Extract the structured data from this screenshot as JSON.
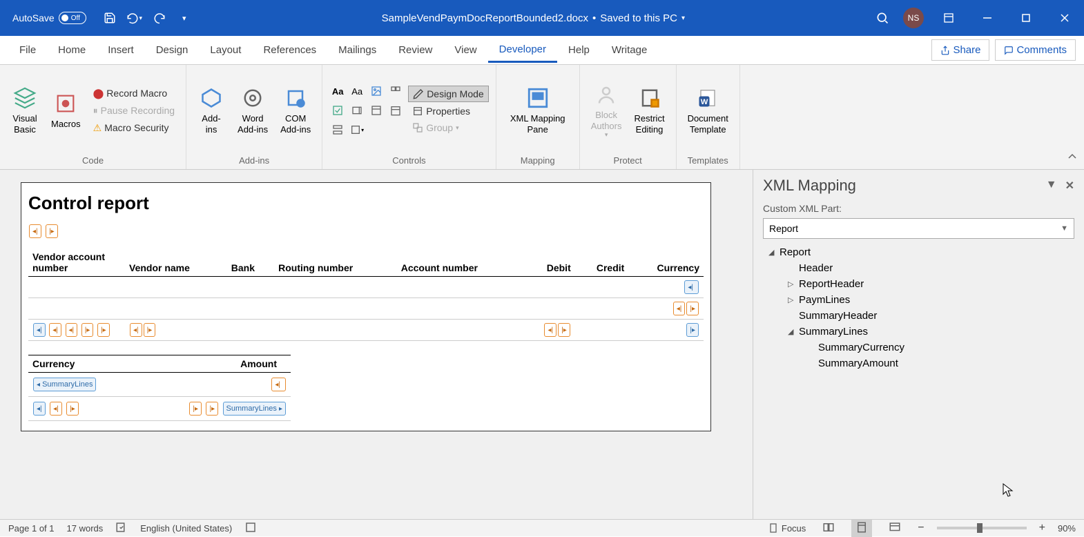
{
  "titlebar": {
    "autosave_label": "AutoSave",
    "autosave_state": "Off",
    "filename": "SampleVendPaymDocReportBounded2.docx",
    "save_status": "Saved to this PC",
    "user_initials": "NS"
  },
  "tabs": {
    "file": "File",
    "home": "Home",
    "insert": "Insert",
    "design": "Design",
    "layout": "Layout",
    "references": "References",
    "mailings": "Mailings",
    "review": "Review",
    "view": "View",
    "developer": "Developer",
    "help": "Help",
    "writage": "Writage",
    "share": "Share",
    "comments": "Comments"
  },
  "ribbon": {
    "code": {
      "label": "Code",
      "visual_basic": "Visual\nBasic",
      "macros": "Macros",
      "record_macro": "Record Macro",
      "pause_recording": "Pause Recording",
      "macro_security": "Macro Security"
    },
    "addins": {
      "label": "Add-ins",
      "add_ins": "Add-\nins",
      "word_addins": "Word\nAdd-ins",
      "com_addins": "COM\nAdd-ins"
    },
    "controls": {
      "label": "Controls",
      "design_mode": "Design Mode",
      "properties": "Properties",
      "group": "Group"
    },
    "mapping": {
      "label": "Mapping",
      "xml_mapping_pane": "XML Mapping\nPane"
    },
    "protect": {
      "label": "Protect",
      "block_authors": "Block\nAuthors",
      "restrict_editing": "Restrict\nEditing"
    },
    "templates": {
      "label": "Templates",
      "document_template": "Document\nTemplate"
    }
  },
  "document": {
    "title": "Control report",
    "columns": {
      "vendor_account": "Vendor account number",
      "vendor_name": "Vendor name",
      "bank": "Bank",
      "routing": "Routing number",
      "account": "Account number",
      "debit": "Debit",
      "credit": "Credit",
      "currency": "Currency"
    },
    "summary": {
      "currency": "Currency",
      "amount": "Amount",
      "summary_lines": "SummaryLines"
    }
  },
  "xml_pane": {
    "title": "XML Mapping",
    "part_label": "Custom XML Part:",
    "selected_part": "Report",
    "tree": {
      "root": "Report",
      "header": "Header",
      "report_header": "ReportHeader",
      "paym_lines": "PaymLines",
      "summary_header": "SummaryHeader",
      "summary_lines": "SummaryLines",
      "summary_currency": "SummaryCurrency",
      "summary_amount": "SummaryAmount"
    }
  },
  "statusbar": {
    "page": "Page 1 of 1",
    "words": "17 words",
    "language": "English (United States)",
    "focus": "Focus",
    "zoom": "90%"
  }
}
